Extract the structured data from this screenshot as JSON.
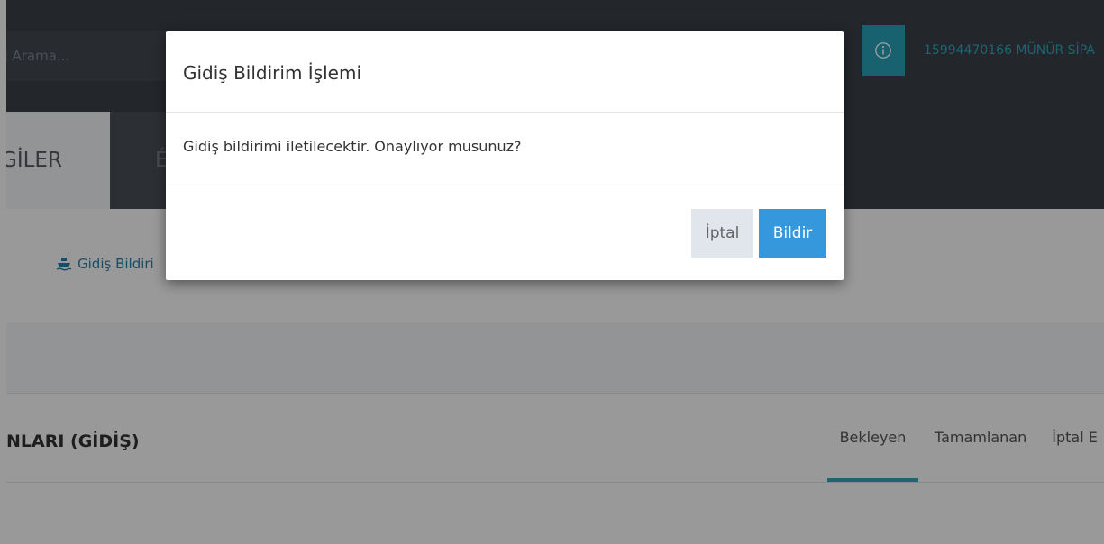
{
  "header": {
    "search_placeholder": "ni Arama...",
    "user": "15994470166 MÜNÜR SİPA"
  },
  "tabs": {
    "active": "GİLER",
    "second": "É"
  },
  "action": {
    "gidis_label": "Gidiş Bildiri"
  },
  "section": {
    "title": "NLARI (GİDİŞ)",
    "status_tabs": [
      "Bekleyen",
      "Tamamlanan",
      "İptal E"
    ]
  },
  "modal": {
    "title": "Gidiş Bildirim İşlemi",
    "message": "Gidiş bildirimi iletilecektir. Onaylıyor musunuz?",
    "cancel_label": "İptal",
    "confirm_label": "Bildir"
  },
  "colors": {
    "topbar": "#3b4049",
    "accent": "#27a4b8",
    "primary_button": "#3598dc",
    "link": "#2a7fa8"
  }
}
